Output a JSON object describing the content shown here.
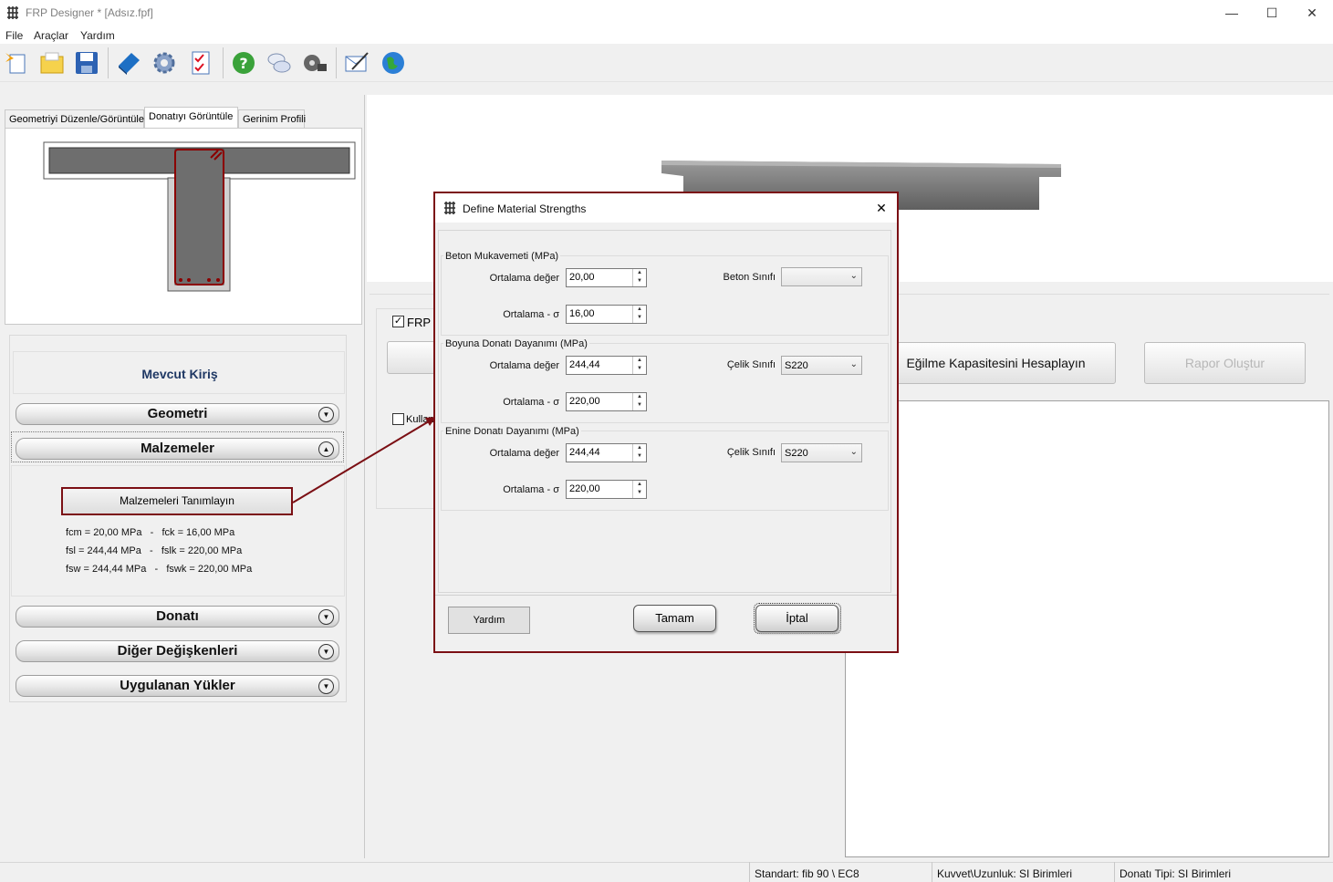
{
  "window": {
    "title": "FRP Designer * [Adsız.fpf]",
    "minimize": "—",
    "maximize": "☐",
    "close": "✕"
  },
  "menu": [
    "File",
    "Araçlar",
    "Yardım"
  ],
  "tabs": [
    "Geometriyi Düzenle/Görüntüle",
    "Donatıyı Görüntüle",
    "Gerinim Profili"
  ],
  "left": {
    "section_title": "Mevcut Kiriş",
    "accordion": [
      "Geometri",
      "Malzemeler",
      "Donatı",
      "Diğer Değişkenleri",
      "Uygulanan Yükler"
    ],
    "define_button": "Malzemeleri Tanımlayın",
    "formulas": [
      "fcm = 20,00 MPa   -   fck = 16,00 MPa",
      "fsl = 244,44 MPa   -   fslk = 220,00 MPa",
      "fsw = 244,44 MPa   -   fswk = 220,00 MPa"
    ]
  },
  "right": {
    "frp_check": "FRP",
    "kullan_check": "Kullan",
    "calc_button": "Eğilme Kapasitesini Hesaplayın",
    "report_button": "Rapor Oluştur"
  },
  "status": {
    "standard": "Standart: fib 90 \\ EC8",
    "units": "Kuvvet\\Uzunluk: SI Birimleri",
    "rebar": "Donatı Tipi: SI Birimleri"
  },
  "dialog": {
    "title": "Define Material Strengths",
    "close": "✕",
    "groups": [
      {
        "label": "Beton Mukavemeti (MPa)",
        "mean_label": "Ortalama değer",
        "mean_value": "20,00",
        "sigma_label": "Ortalama - σ",
        "sigma_value": "16,00",
        "class_label": "Beton Sınıfı",
        "class_value": ""
      },
      {
        "label": "Boyuna Donatı Dayanımı (MPa)",
        "mean_label": "Ortalama değer",
        "mean_value": "244,44",
        "sigma_label": "Ortalama - σ",
        "sigma_value": "220,00",
        "class_label": "Çelik Sınıfı",
        "class_value": "S220"
      },
      {
        "label": "Enine Donatı Dayanımı (MPa)",
        "mean_label": "Ortalama değer",
        "mean_value": "244,44",
        "sigma_label": "Ortalama - σ",
        "sigma_value": "220,00",
        "class_label": "Çelik Sınıfı",
        "class_value": "S220"
      }
    ],
    "help_button": "Yardım",
    "ok_button": "Tamam",
    "cancel_button": "İptal"
  },
  "colors": {
    "highlight": "#7b0f14",
    "section_title": "#1f3864"
  }
}
